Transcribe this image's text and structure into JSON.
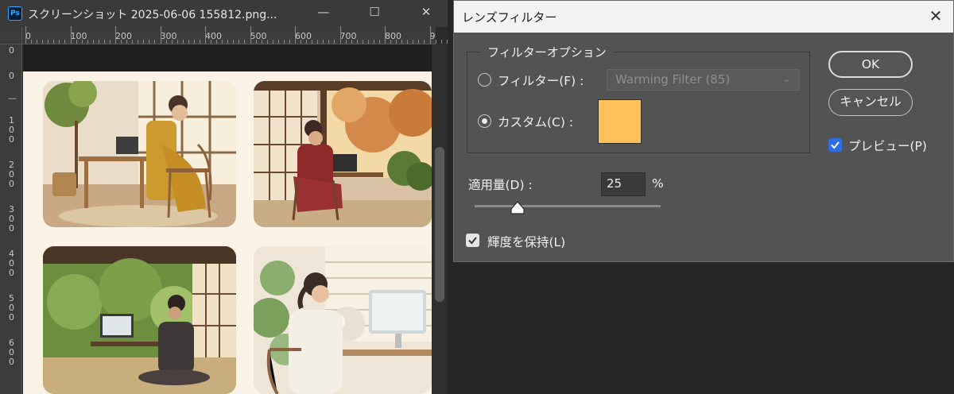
{
  "document_window": {
    "app_icon": "Ps",
    "title": "スクリーンショット 2025-06-06 155812.png...",
    "controls": {
      "minimize": "—",
      "maximize": "☐",
      "close": "✕"
    },
    "ruler_top": [
      "0",
      "100",
      "200",
      "300",
      "400",
      "500",
      "600",
      "700",
      "800",
      "9"
    ],
    "ruler_left": [
      [
        "0"
      ],
      [
        "0"
      ],
      [
        "—"
      ],
      [
        "1",
        "0",
        "0"
      ],
      [
        "2",
        "0",
        "0"
      ],
      [
        "3",
        "0",
        "0"
      ],
      [
        "4",
        "0",
        "0"
      ],
      [
        "5",
        "0",
        "0"
      ],
      [
        "6",
        "0",
        "0"
      ]
    ]
  },
  "dialog": {
    "title": "レンズフィルター",
    "close": "✕",
    "group_label": "フィルターオプション",
    "filter_label": "フィルター(F) :",
    "filter_value": "Warming Filter (85)",
    "filter_selected": false,
    "custom_label": "カスタム(C) :",
    "custom_selected": true,
    "custom_color": "#ffc15a",
    "density_label": "適用量(D) :",
    "density_value": "25",
    "density_unit": "%",
    "density_fraction": 0.25,
    "preserve_label": "輝度を保持(L)",
    "preserve_checked": true,
    "ok_label": "OK",
    "cancel_label": "キャンセル",
    "preview_label": "プレビュー(P)",
    "preview_checked": true,
    "preview_check_color": "#2d6ee4"
  }
}
